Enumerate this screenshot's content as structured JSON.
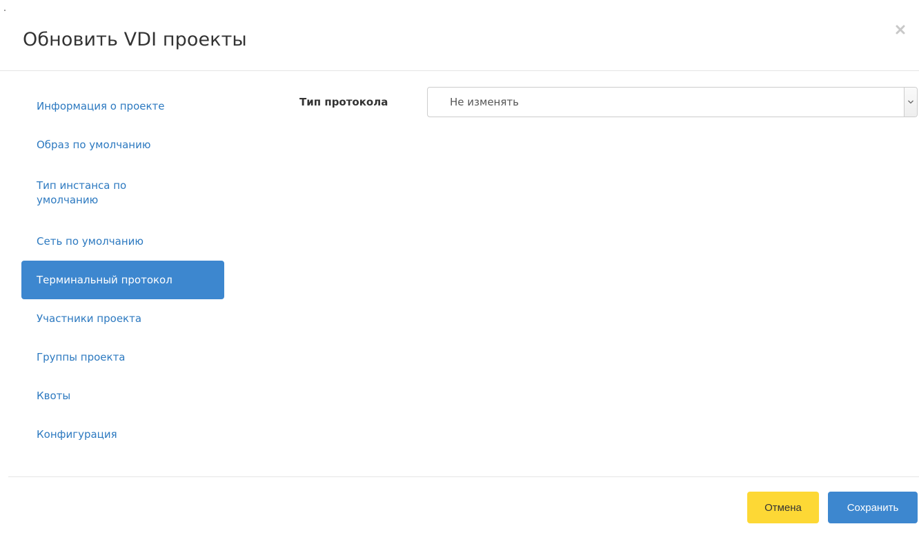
{
  "dialog": {
    "title": "Обновить VDI проекты",
    "close_icon": "close-icon"
  },
  "sidebar": {
    "items": [
      {
        "label": "Информация о проекте",
        "active": false
      },
      {
        "label": "Образ по умолчанию",
        "active": false
      },
      {
        "label": "Тип инстанса по умолчанию",
        "active": false
      },
      {
        "label": "Сеть по умолчанию",
        "active": false
      },
      {
        "label": "Терминальный протокол",
        "active": true
      },
      {
        "label": "Участники проекта",
        "active": false
      },
      {
        "label": "Группы проекта",
        "active": false
      },
      {
        "label": "Квоты",
        "active": false
      },
      {
        "label": "Конфигурация",
        "active": false
      }
    ]
  },
  "form": {
    "protocol_label": "Тип протокола",
    "protocol_value": "Не изменять",
    "dropdown_icon": "chevron-down-icon"
  },
  "footer": {
    "cancel_label": "Отмена",
    "save_label": "Сохранить"
  },
  "colors": {
    "accent": "#3d87cf",
    "link": "#2c79c0",
    "cancel": "#fdd835"
  }
}
